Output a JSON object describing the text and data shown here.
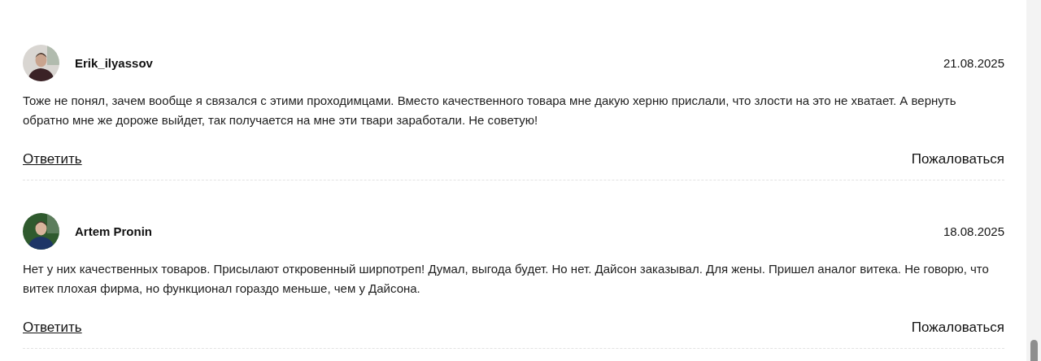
{
  "reviews": [
    {
      "author": "Erik_ilyassov",
      "date": "21.08.2025",
      "text": "Тоже не понял, зачем вообще я связался с этими проходимцами. Вместо качественного товара мне дакую херню прислали, что злости на это не хватает. А вернуть обратно мне же дороже выйдет, так получается на мне эти твари заработали. Не советую!",
      "reply": "Ответить",
      "report": "Пожаловаться"
    },
    {
      "author": "Artem Pronin",
      "date": "18.08.2025",
      "text": "Нет у них качественных товаров. Присылают откровенный ширпотреп! Думал, выгода будет. Но нет. Дайсон заказывал. Для жены. Пришел аналог витека. Не говорю, что витек плохая фирма, но функционал гораздо меньше, чем у Дайсона.",
      "reply": "Ответить",
      "report": "Пожаловаться"
    }
  ]
}
